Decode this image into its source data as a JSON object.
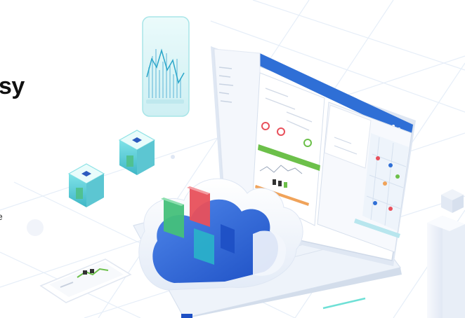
{
  "hero": {
    "heading_fragment": "sy",
    "body_fragment": "e"
  },
  "illustration": {
    "icons": [
      "cloud-icon",
      "laptop-icon",
      "smartphone-icon",
      "server-cube-icon",
      "chart-panel-icon",
      "map-pin-icon"
    ],
    "colors": {
      "background": "#ffffff",
      "grid": "#e6eef8",
      "laptop_body": "#eef3fa",
      "screen_header": "#2f6fd6",
      "cloud_light": "#f3f6fc",
      "cloud_blue": "#2b63d9",
      "card_green": "#44c07a",
      "card_red": "#e8505b",
      "card_teal": "#2ab0c9",
      "cube_teal": "#7fe3e8",
      "cube_green": "#4fc08a",
      "progress_green": "#6cc04a"
    }
  }
}
